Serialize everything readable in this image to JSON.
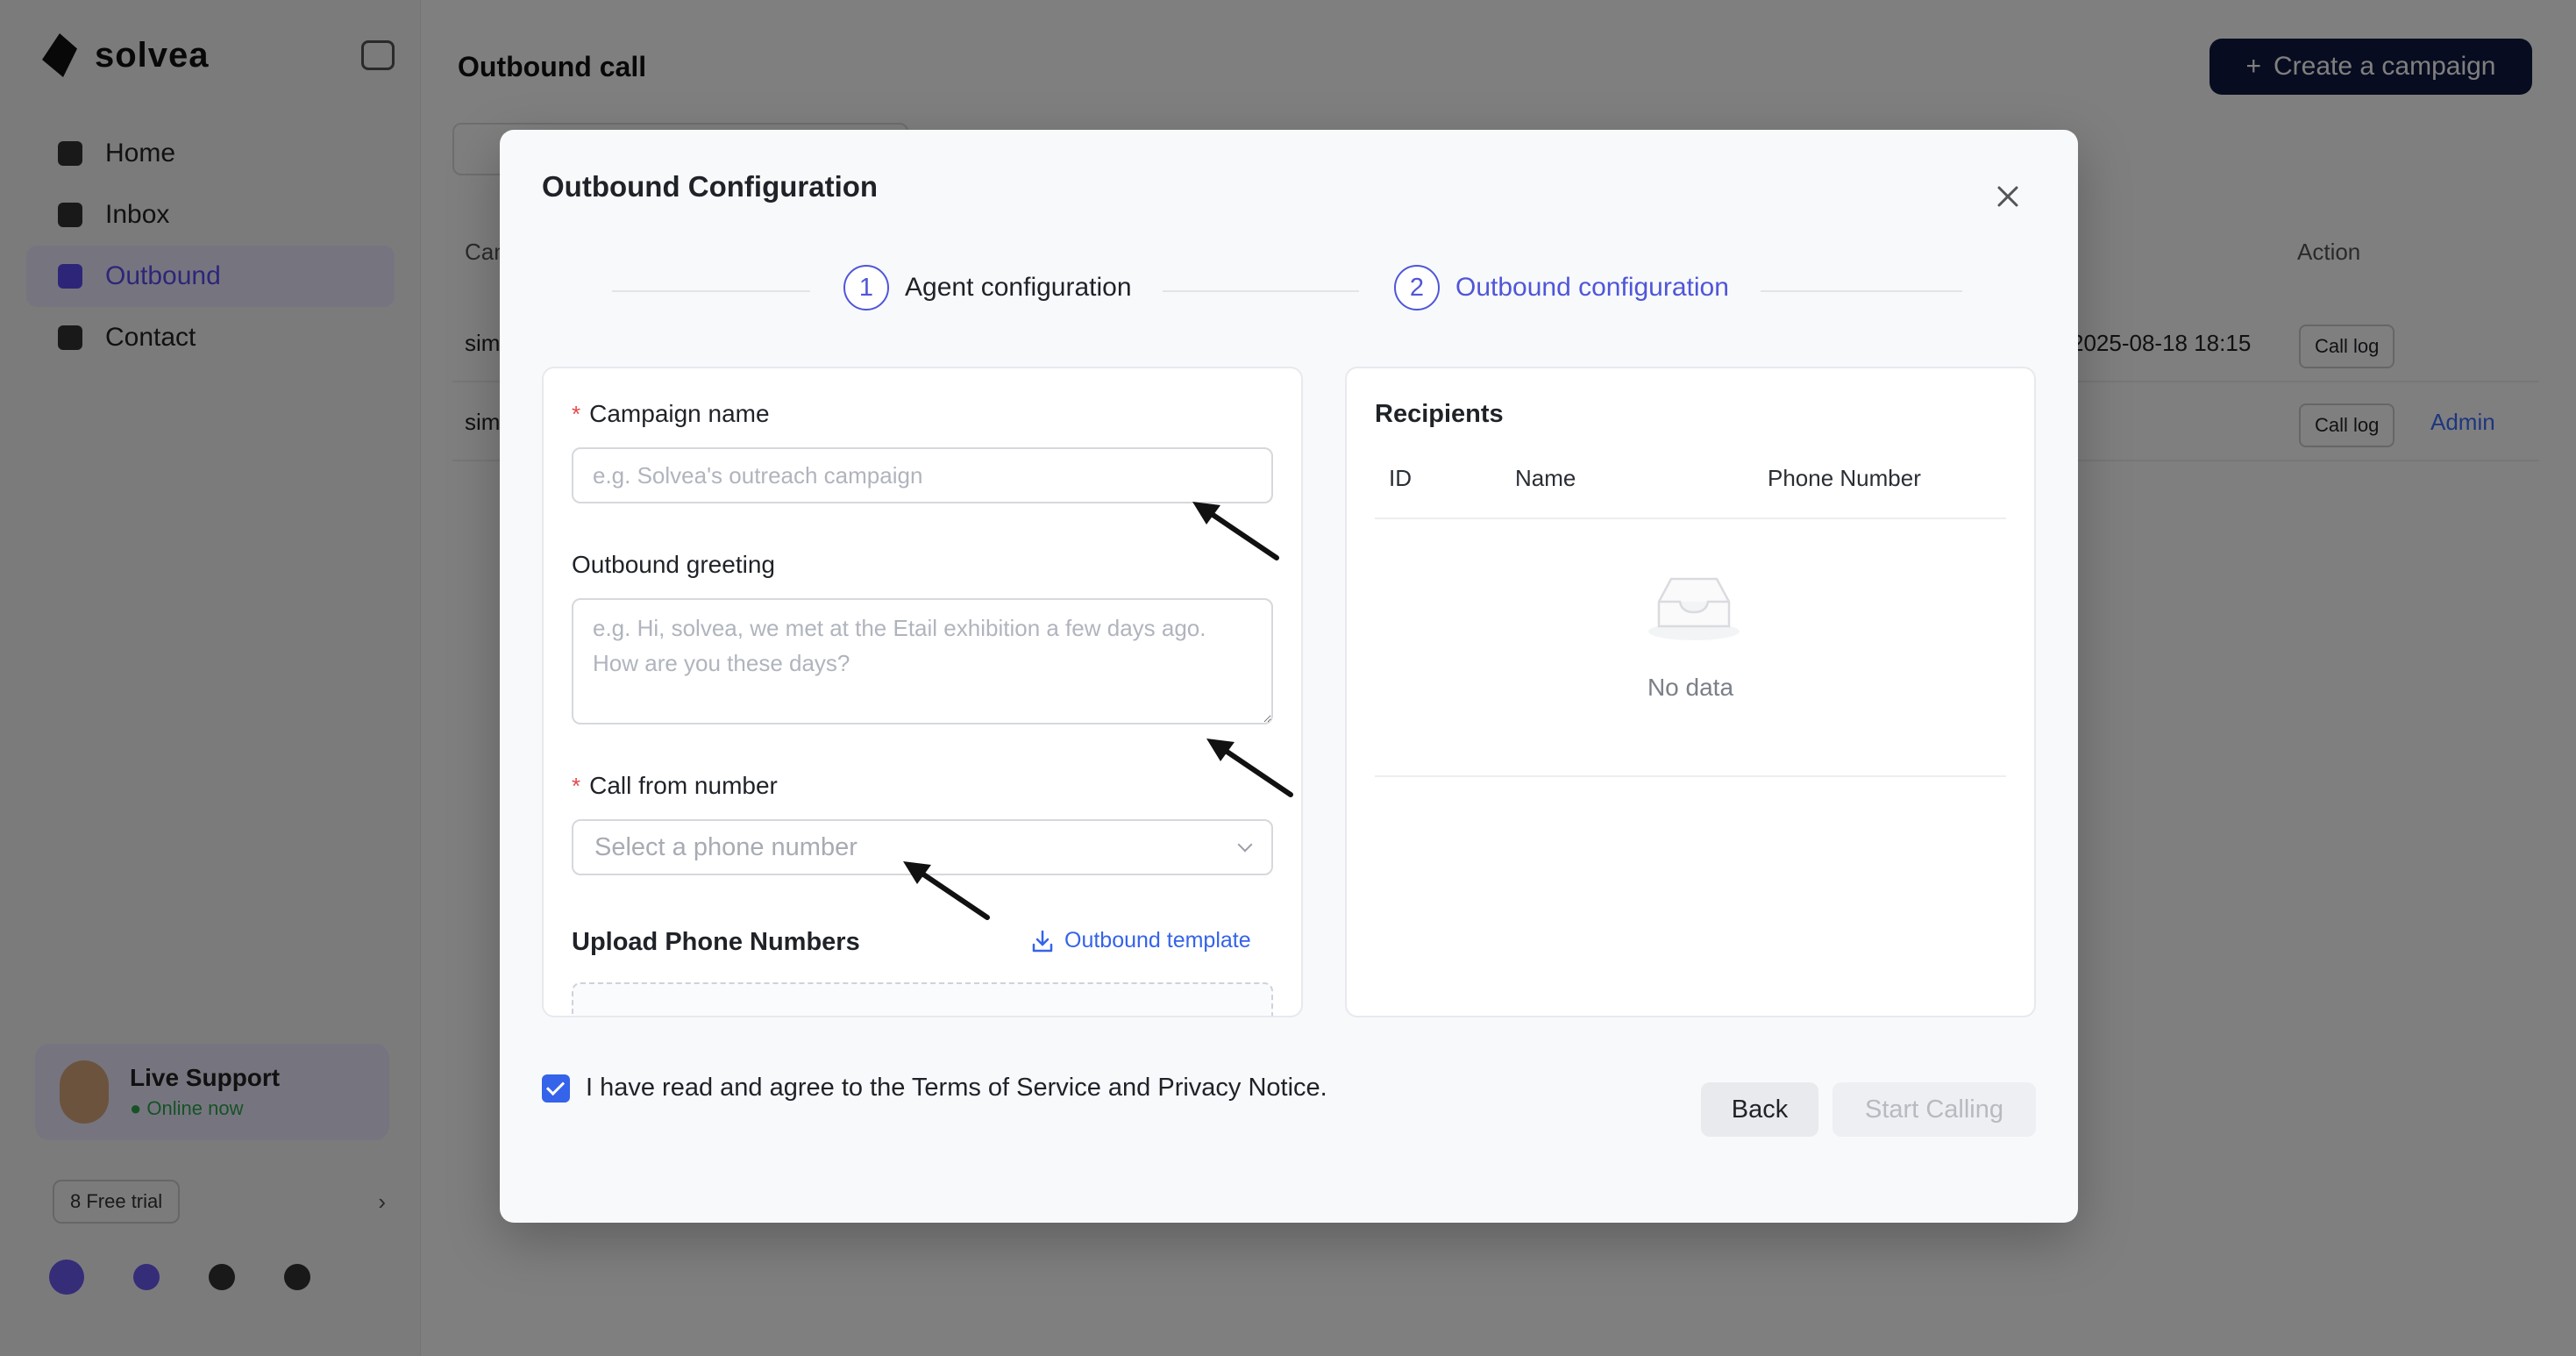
{
  "app": {
    "brand": "solvea",
    "nav": [
      {
        "label": "Home",
        "icon": "home-icon"
      },
      {
        "label": "Inbox",
        "icon": "inbox-icon"
      },
      {
        "label": "Outbound",
        "icon": "phone-icon"
      },
      {
        "label": "Contact",
        "icon": "contact-icon"
      }
    ],
    "support": {
      "title": "Live Support",
      "status": "● Online now"
    },
    "plan_label": "8 Free trial",
    "page_title": "Outbound call",
    "create_button": "Create a campaign",
    "table": {
      "headers": [
        "Campaign",
        "",
        "",
        "Action"
      ],
      "rows": [
        {
          "name": "sim",
          "date": "2025-08-18 18:15",
          "action": "Call log",
          "link": ""
        },
        {
          "name": "sim",
          "date": "",
          "action": "Call log",
          "link": "Admin"
        }
      ]
    }
  },
  "modal": {
    "title": "Outbound Configuration",
    "steps": [
      {
        "number": "1",
        "label": "Agent configuration"
      },
      {
        "number": "2",
        "label": "Outbound configuration"
      }
    ],
    "form": {
      "campaign_name": {
        "label": "Campaign name",
        "required": "*",
        "placeholder": "e.g. Solvea's outreach campaign",
        "value": ""
      },
      "greeting": {
        "label": "Outbound greeting",
        "placeholder": "e.g. Hi, solvea, we met at the Etail exhibition a few days ago. How are you these days?",
        "value": ""
      },
      "call_from": {
        "label": "Call from number",
        "required": "*",
        "placeholder": "Select a phone number"
      },
      "upload": {
        "title": "Upload Phone Numbers",
        "template_link": "Outbound template"
      }
    },
    "recipients": {
      "title": "Recipients",
      "columns": [
        "ID",
        "Name",
        "Phone Number"
      ],
      "empty_text": "No data"
    },
    "agreement": "I have read and agree to the Terms of Service and Privacy Notice.",
    "back_button": "Back",
    "start_button": "Start Calling"
  },
  "colors": {
    "accent": "#4f56d8",
    "link": "#3563e9",
    "required": "#e5484d",
    "overlay": "rgba(0,0,0,0.5)"
  }
}
